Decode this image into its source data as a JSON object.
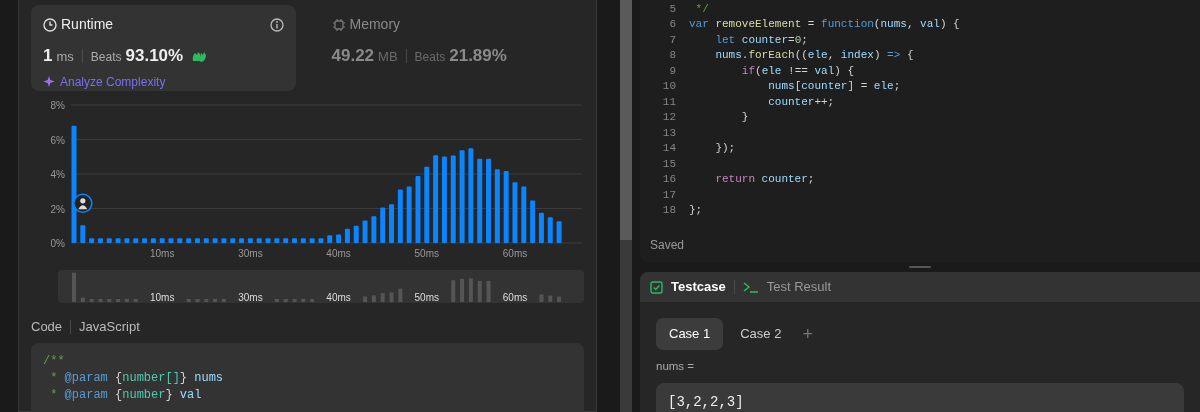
{
  "runtime": {
    "title": "Runtime",
    "value": "1",
    "unit": "ms",
    "beats_label": "Beats",
    "beats": "93.10%",
    "action": "Analyze Complexity",
    "selected": true
  },
  "memory": {
    "title": "Memory",
    "value": "49.22",
    "unit": "MB",
    "beats_label": "Beats",
    "beats": "21.89%",
    "selected": false
  },
  "chart_data": {
    "type": "bar",
    "categories": [
      null,
      null,
      null,
      null,
      null,
      null,
      null,
      null,
      null,
      null,
      "10ms",
      null,
      null,
      null,
      null,
      null,
      null,
      null,
      null,
      null,
      "30ms",
      null,
      null,
      null,
      null,
      null,
      null,
      null,
      null,
      null,
      "40ms",
      null,
      null,
      null,
      null,
      null,
      null,
      null,
      null,
      null,
      "50ms",
      null,
      null,
      null,
      null,
      null,
      null,
      null,
      null,
      null,
      "60ms",
      null,
      null,
      null,
      null,
      null
    ],
    "series": [
      {
        "color": "#0a84ff",
        "values": [
          6.8,
          1.03,
          0.27,
          0.27,
          0.27,
          0.27,
          0.27,
          0.27,
          0.27,
          0.27,
          0.27,
          0.27,
          0.27,
          0.27,
          0.27,
          0.27,
          0.27,
          0.27,
          0.27,
          0.27,
          0.27,
          0.27,
          0.27,
          0.27,
          0.27,
          0.27,
          0.27,
          0.27,
          0.27,
          0.45,
          0.5,
          0.83,
          1.0,
          1.3,
          1.55,
          2.06,
          2.24,
          3.1,
          3.27,
          3.88,
          4.42,
          5.09,
          5.02,
          5.07,
          5.38,
          5.49,
          4.89,
          4.89,
          4.28,
          4.17,
          3.52,
          3.27,
          2.47,
          1.75,
          1.5,
          1.26
        ]
      }
    ],
    "ylim": [
      0,
      8
    ],
    "yticks": [
      {
        "value": 0,
        "label": "0%"
      },
      {
        "value": 2,
        "label": "2%"
      },
      {
        "value": 4,
        "label": "4%"
      },
      {
        "value": 6,
        "label": "6%"
      },
      {
        "value": 8,
        "label": "8%"
      }
    ],
    "grid": true
  },
  "navigator_labels": [
    "10ms",
    "30ms",
    "40ms",
    "50ms",
    "60ms"
  ],
  "code_header": {
    "title": "Code",
    "language": "JavaScript"
  },
  "code_preview": [
    {
      "tokens": [
        {
          "kind": "comment",
          "text": "/**"
        }
      ]
    },
    {
      "tokens": [
        {
          "kind": "comment",
          "text": " * "
        },
        {
          "kind": "keyword",
          "text": "@param"
        },
        {
          "kind": "plain",
          "text": " {"
        },
        {
          "kind": "type",
          "text": "number[]"
        },
        {
          "kind": "plain",
          "text": "}"
        },
        {
          "kind": "variable",
          "text": " nums"
        }
      ]
    },
    {
      "tokens": [
        {
          "kind": "comment",
          "text": " * "
        },
        {
          "kind": "keyword",
          "text": "@param"
        },
        {
          "kind": "plain",
          "text": " {"
        },
        {
          "kind": "type",
          "text": "number"
        },
        {
          "kind": "plain",
          "text": "}"
        },
        {
          "kind": "variable",
          "text": " val"
        }
      ]
    }
  ],
  "editor": {
    "lines": [
      {
        "number": "5",
        "tokens": [
          {
            "kind": "comment",
            "text": " */"
          }
        ]
      },
      {
        "number": "6",
        "tokens": [
          {
            "kind": "keyword",
            "text": "var"
          },
          {
            "kind": "function",
            "text": " removeElement"
          },
          {
            "kind": "plain",
            "text": " = "
          },
          {
            "kind": "keyword",
            "text": "function"
          },
          {
            "kind": "plain",
            "text": "("
          },
          {
            "kind": "variable",
            "text": "nums"
          },
          {
            "kind": "plain",
            "text": ", "
          },
          {
            "kind": "variable",
            "text": "val"
          },
          {
            "kind": "plain",
            "text": ") {"
          }
        ]
      },
      {
        "number": "7",
        "tokens": [
          {
            "kind": "keyword",
            "text": "    let"
          },
          {
            "kind": "variable",
            "text": " counter"
          },
          {
            "kind": "plain",
            "text": "="
          },
          {
            "kind": "number",
            "text": "0"
          },
          {
            "kind": "plain",
            "text": ";"
          }
        ]
      },
      {
        "number": "8",
        "tokens": [
          {
            "kind": "variable",
            "text": "    nums"
          },
          {
            "kind": "plain",
            "text": "."
          },
          {
            "kind": "function",
            "text": "forEach"
          },
          {
            "kind": "plain",
            "text": "(("
          },
          {
            "kind": "variable",
            "text": "ele"
          },
          {
            "kind": "plain",
            "text": ", "
          },
          {
            "kind": "variable",
            "text": "index"
          },
          {
            "kind": "plain",
            "text": ") "
          },
          {
            "kind": "keyword",
            "text": "=>"
          },
          {
            "kind": "plain",
            "text": " {"
          }
        ]
      },
      {
        "number": "9",
        "tokens": [
          {
            "kind": "control",
            "text": "        if"
          },
          {
            "kind": "plain",
            "text": "("
          },
          {
            "kind": "variable",
            "text": "ele"
          },
          {
            "kind": "plain",
            "text": " !== "
          },
          {
            "kind": "variable",
            "text": "val"
          },
          {
            "kind": "plain",
            "text": ") {"
          }
        ]
      },
      {
        "number": "10",
        "tokens": [
          {
            "kind": "variable",
            "text": "            nums"
          },
          {
            "kind": "plain",
            "text": "["
          },
          {
            "kind": "variable",
            "text": "counter"
          },
          {
            "kind": "plain",
            "text": "] = "
          },
          {
            "kind": "variable",
            "text": "ele"
          },
          {
            "kind": "plain",
            "text": ";"
          }
        ]
      },
      {
        "number": "11",
        "tokens": [
          {
            "kind": "variable",
            "text": "            counter"
          },
          {
            "kind": "plain",
            "text": "++;"
          }
        ]
      },
      {
        "number": "12",
        "tokens": [
          {
            "kind": "plain",
            "text": "        }"
          }
        ]
      },
      {
        "number": "13"
      },
      {
        "number": "14",
        "tokens": [
          {
            "kind": "plain",
            "text": "    });"
          }
        ]
      },
      {
        "number": "15"
      },
      {
        "number": "16",
        "tokens": [
          {
            "kind": "control",
            "text": "    return"
          },
          {
            "kind": "variable",
            "text": " counter"
          },
          {
            "kind": "plain",
            "text": ";"
          }
        ]
      },
      {
        "number": "17"
      },
      {
        "number": "18",
        "tokens": [
          {
            "kind": "plain",
            "text": "};"
          }
        ]
      }
    ],
    "status": "Saved"
  },
  "console": {
    "tabs": [
      {
        "label": "Testcase",
        "kind": "testcase",
        "selected": true
      },
      {
        "label": "Test Result",
        "kind": "result",
        "selected": false
      }
    ],
    "cases": [
      {
        "label": "Case 1",
        "selected": true
      },
      {
        "label": "Case 2",
        "selected": false
      }
    ],
    "add_label": "+",
    "params": [
      {
        "name": "nums =",
        "value": "[3,2,2,3]"
      }
    ]
  }
}
